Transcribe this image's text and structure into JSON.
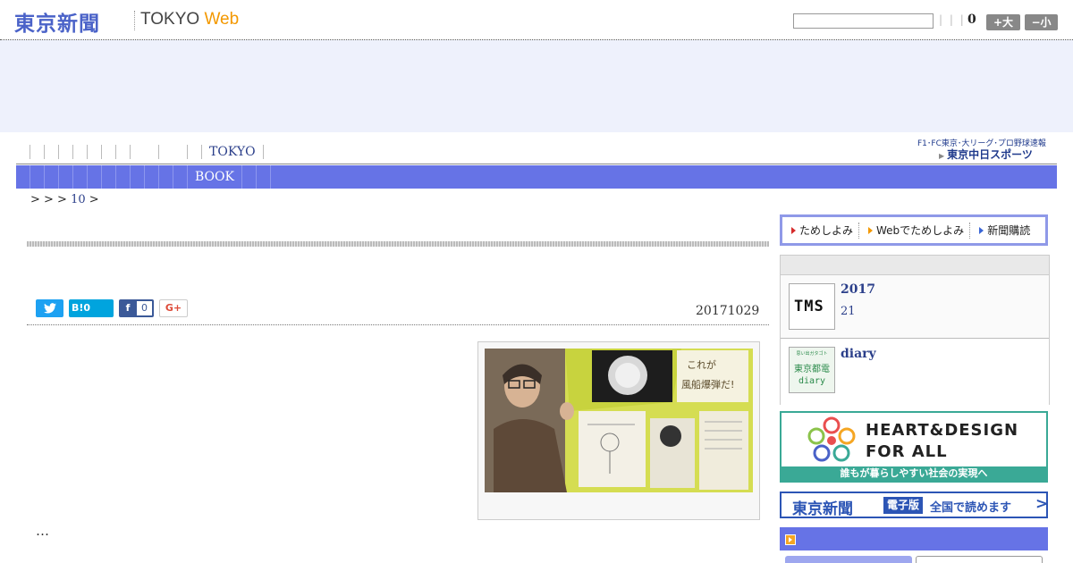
{
  "header": {
    "logo_jp": "東京新聞",
    "logo_en": "TOKYO",
    "logo_web": "Web",
    "separators": "| | |",
    "count": "0",
    "font_large": "+大",
    "font_small": "−小"
  },
  "nav": {
    "primary_label": "TOKYO",
    "secondary_label": "BOOK",
    "sponsor_line1": "F1･FC東京･大リーグ･プロ野球速報",
    "sponsor_line2": "東京中日スポーツ"
  },
  "breadcrumb": {
    "prefix": "> > >",
    "link": "10",
    "suffix": ">"
  },
  "article": {
    "date": "20171029",
    "ellipsis": "…",
    "photo_caption_text": "これが風船爆弾だ!"
  },
  "share": {
    "hatena_label": "B!",
    "hatena_count": "0",
    "facebook_count": "0",
    "googleplus_label": "G+"
  },
  "sidebar": {
    "trial_items": [
      "ためしよみ",
      "Webでためしよみ",
      "新聞購読"
    ],
    "widget_item1": {
      "thumb": "TMS",
      "title": "2017",
      "sub": "21"
    },
    "widget_item2": {
      "thumb_top": "思い出ガタゴト",
      "thumb_mid": "東京都電",
      "thumb_bottom": "diary",
      "title": "diary"
    },
    "heart_line1": "HEART&DESIGN",
    "heart_line2": "FOR ALL",
    "heart_strip": "誰もが暮らしやすい社会の実現へ",
    "digital_logo": "東京新聞",
    "digital_tag": "電子版",
    "digital_text": "全国で読めます",
    "digital_chevron": ">"
  },
  "colors": {
    "brand_blue": "#4a62c8",
    "nav_blue": "#6673e6",
    "web_orange": "#f39800",
    "heart_teal": "#3aa996"
  }
}
